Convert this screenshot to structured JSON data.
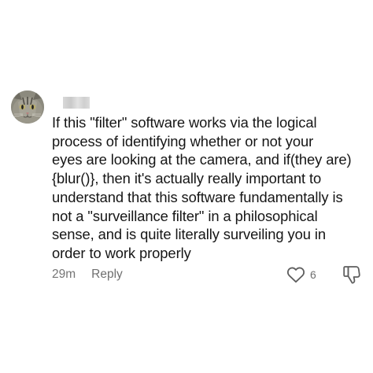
{
  "comment": {
    "username": "username",
    "avatar_icon": "cat-avatar-icon",
    "text_lines": [
      "If this \"filter\" software works via the logical",
      "process of identifying whether or not your",
      "eyes are looking at the camera, and if(they are)",
      "{blur()}, then it's actually really important to",
      "understand that this software fundamentally is",
      "not a \"surveillance filter\" in a philosophical",
      "sense, and is quite literally surveiling you in",
      "order to work properly"
    ],
    "timestamp": "29m",
    "reply_label": "Reply",
    "like_count": "6",
    "like_icon": "heart-outline-icon",
    "dislike_icon": "thumbs-down-icon"
  },
  "colors": {
    "background": "#ffffff",
    "text": "#161616",
    "meta": "#757575",
    "icon": "#5f5f5f"
  }
}
